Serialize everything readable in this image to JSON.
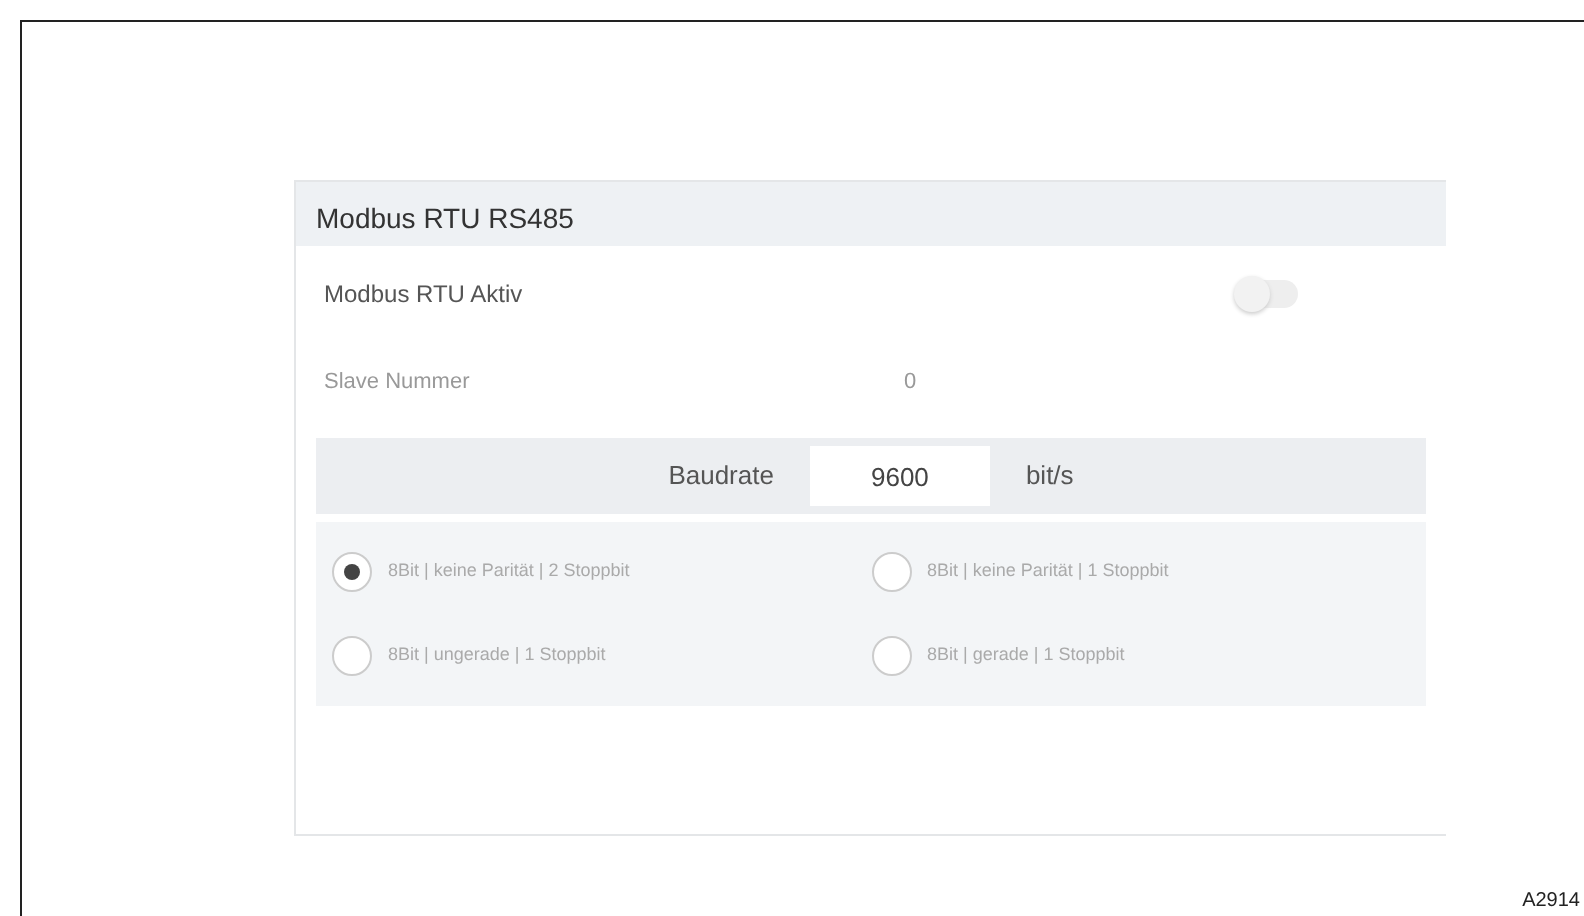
{
  "card": {
    "title": "Modbus RTU RS485"
  },
  "active": {
    "label": "Modbus RTU Aktiv",
    "on": false
  },
  "slave": {
    "label": "Slave Nummer",
    "value": "0"
  },
  "baudrate": {
    "label": "Baudrate",
    "value": "9600",
    "unit": "bit/s"
  },
  "options": [
    {
      "label": "8Bit | keine Parität | 2 Stoppbit",
      "selected": true
    },
    {
      "label": "8Bit | keine Parität | 1 Stoppbit",
      "selected": false
    },
    {
      "label": "8Bit | ungerade | 1 Stoppbit",
      "selected": false
    },
    {
      "label": "8Bit | gerade | 1 Stoppbit",
      "selected": false
    }
  ],
  "figure_id": "A2914"
}
